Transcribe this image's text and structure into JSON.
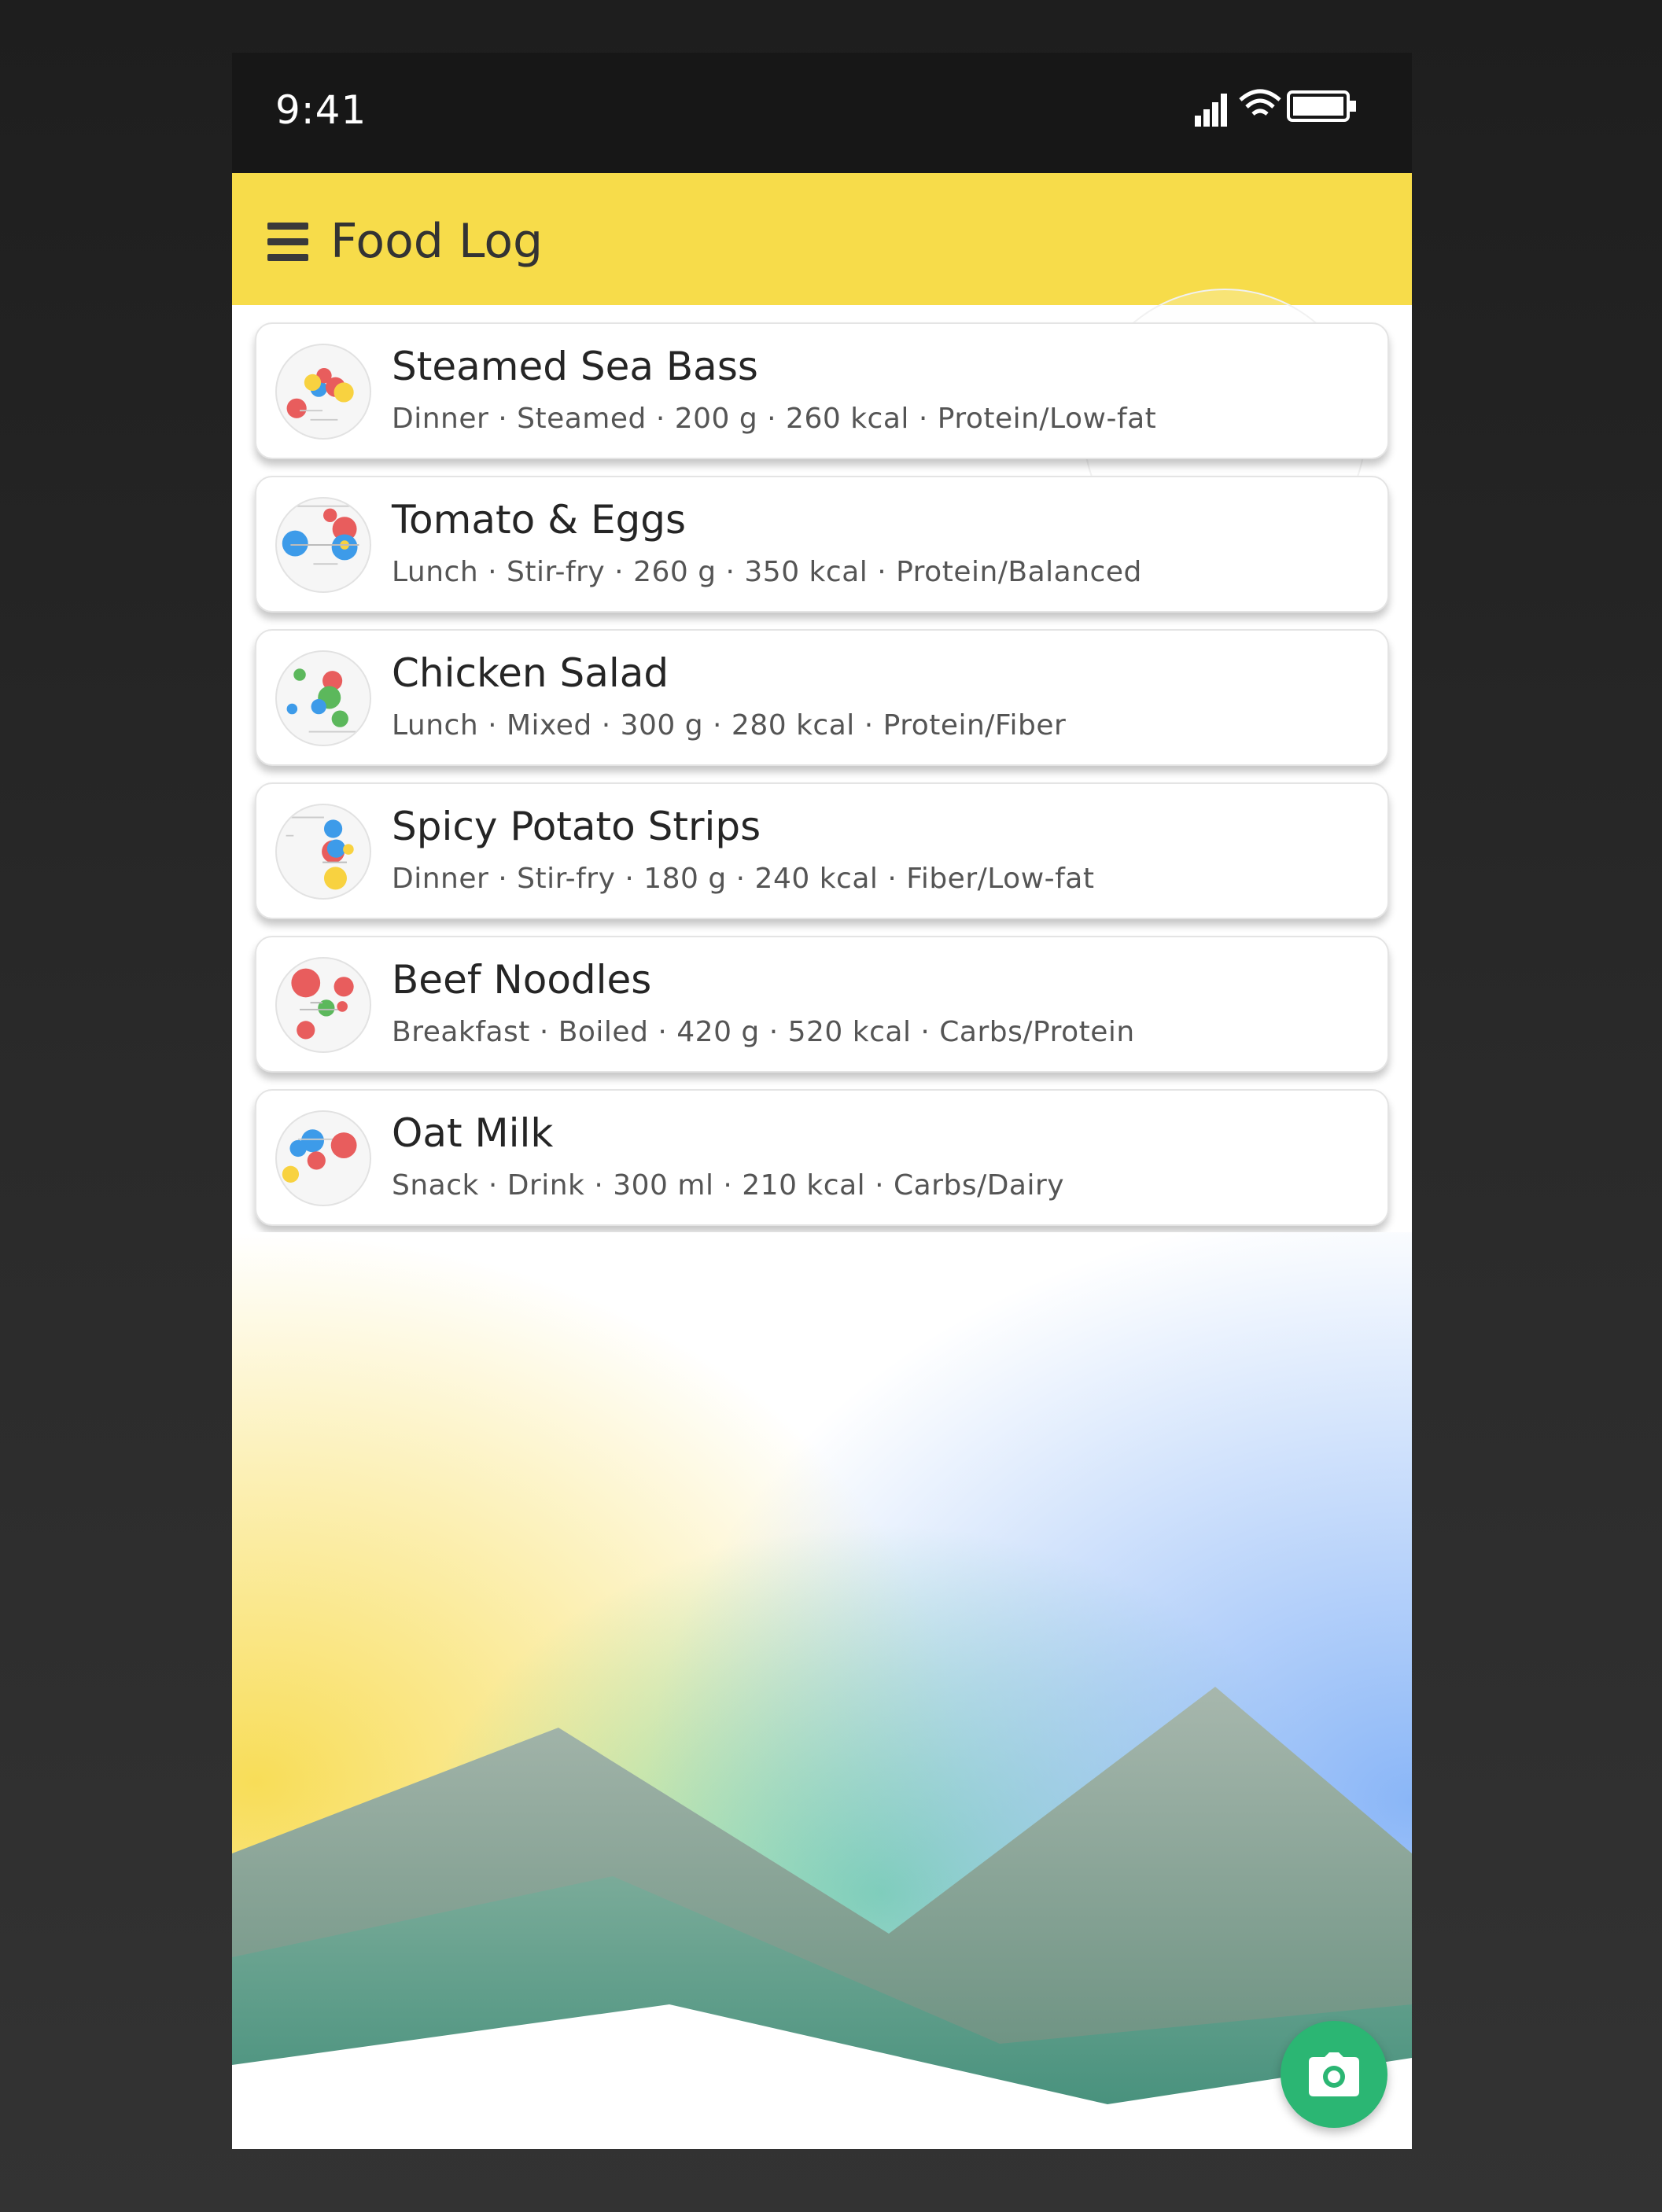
{
  "status_bar": {
    "time": "9:41",
    "icons": [
      "signal-icon",
      "wifi-icon",
      "battery-icon"
    ]
  },
  "app_bar": {
    "title": "Food Log",
    "menu_icon": "menu-icon"
  },
  "foods": [
    {
      "name": "Steamed Sea Bass",
      "details": "Dinner · Steamed · 200 g · 260 kcal · Protein/Low-fat"
    },
    {
      "name": "Tomato & Eggs",
      "details": "Lunch · Stir-fry · 260 g · 350 kcal · Protein/Balanced"
    },
    {
      "name": "Chicken Salad",
      "details": "Lunch · Mixed · 300 g · 280 kcal · Protein/Fiber"
    },
    {
      "name": "Spicy Potato Strips",
      "details": "Dinner · Stir-fry · 180 g · 240 kcal · Fiber/Low-fat"
    },
    {
      "name": "Beef Noodles",
      "details": "Breakfast · Boiled · 420 g · 520 kcal · Carbs/Protein"
    },
    {
      "name": "Oat Milk",
      "details": "Snack · Drink · 300 ml · 210 kcal · Carbs/Dairy"
    }
  ],
  "fab": {
    "icon": "camera-icon"
  },
  "colors": {
    "app_bar": "#f7dc4a",
    "status_bar": "#171717",
    "fab": "#2bb673",
    "dot_red": "#e85d5d",
    "dot_blue": "#3d9be9",
    "dot_yellow": "#f8d240",
    "dot_green": "#5cb85c"
  }
}
